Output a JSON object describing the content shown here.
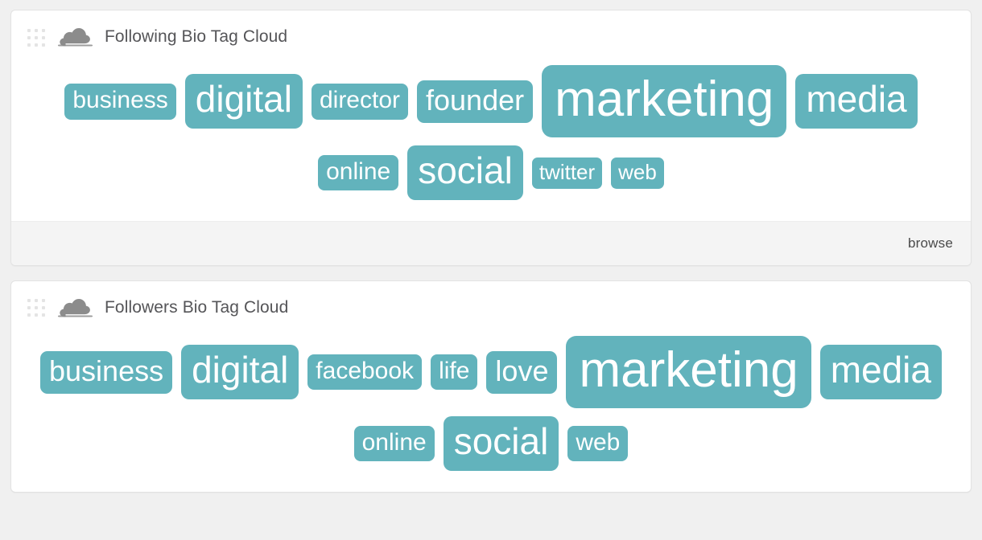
{
  "theme": {
    "page_background": "#f0f0f0",
    "panel_background": "#ffffff",
    "tag_background": "#62b3bc",
    "tag_text": "#ffffff",
    "title_text": "#555558",
    "footer_background": "#f4f4f4",
    "icon_gray": "#8c8c8c"
  },
  "panels": [
    {
      "id": "following-bio-tag-cloud",
      "drag_handle_icon": "grid-dots-icon",
      "icon": "cloud-icon",
      "title": "Following Bio Tag Cloud",
      "tag_rows": [
        [
          {
            "label": "business",
            "size": "s3"
          },
          {
            "label": "digital",
            "size": "s5"
          },
          {
            "label": "director",
            "size": "s3"
          },
          {
            "label": "founder",
            "size": "s4"
          },
          {
            "label": "marketing",
            "size": "s6"
          },
          {
            "label": "media",
            "size": "s5"
          }
        ],
        [
          {
            "label": "online",
            "size": "s3"
          },
          {
            "label": "social",
            "size": "s5"
          },
          {
            "label": "twitter",
            "size": "s2"
          },
          {
            "label": "web",
            "size": "s2"
          }
        ]
      ],
      "footer": {
        "browse_label": "browse"
      }
    },
    {
      "id": "followers-bio-tag-cloud",
      "drag_handle_icon": "grid-dots-icon",
      "icon": "cloud-icon",
      "title": "Followers Bio Tag Cloud",
      "tag_rows": [
        [
          {
            "label": "business",
            "size": "s4"
          },
          {
            "label": "digital",
            "size": "s5"
          },
          {
            "label": "facebook",
            "size": "s3"
          },
          {
            "label": "life",
            "size": "s3"
          },
          {
            "label": "love",
            "size": "s4"
          },
          {
            "label": "marketing",
            "size": "s6"
          },
          {
            "label": "media",
            "size": "s5"
          }
        ],
        [
          {
            "label": "online",
            "size": "s3"
          },
          {
            "label": "social",
            "size": "s5"
          },
          {
            "label": "web",
            "size": "s3"
          }
        ]
      ],
      "footer": null
    }
  ]
}
